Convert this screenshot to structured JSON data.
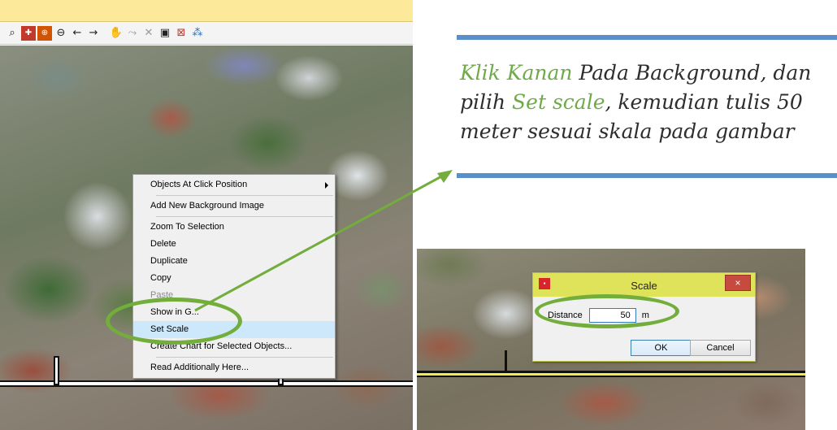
{
  "toolbar": {
    "icons": [
      "zoom-fit-icon",
      "zoom-extent-icon",
      "zoom-in-icon",
      "zoom-out-icon",
      "back-arrow-icon",
      "forward-arrow-icon",
      "pan-hand-icon",
      "route-icon",
      "delete-route-icon",
      "camera-icon",
      "remove-objects-icon",
      "network-icon"
    ]
  },
  "context_menu": {
    "items": [
      {
        "label": "Objects At Click Position",
        "submenu": true,
        "enabled": true
      },
      {
        "label": "Add New Background Image",
        "enabled": true
      },
      {
        "label": "Zoom To Selection",
        "enabled": true
      },
      {
        "label": "Delete",
        "enabled": true
      },
      {
        "label": "Duplicate",
        "enabled": true
      },
      {
        "label": "Copy",
        "enabled": true
      },
      {
        "label": "Paste",
        "enabled": false
      },
      {
        "label": "Show in G...",
        "enabled": true
      },
      {
        "label": "Set Scale",
        "enabled": true,
        "highlighted": true
      },
      {
        "label": "Create Chart for Selected Objects...",
        "enabled": true
      },
      {
        "label": "Read Additionally Here...",
        "enabled": true
      }
    ]
  },
  "instruction": {
    "part1_accent": "Klik Kanan",
    "part2": " Pada Background, dan pilih ",
    "part3_accent": "Set scale",
    "part4": ", kemudian tulis 50 meter sesuai skala pada gambar"
  },
  "colors": {
    "accent_green": "#6faa48",
    "rule_blue": "#5b8fc9",
    "highlight_ellipse": "#73ad3c"
  },
  "scale_dialog": {
    "title": "Scale",
    "close_label": "×",
    "distance_label": "Distance",
    "distance_value": "50",
    "unit": "m",
    "ok_label": "OK",
    "cancel_label": "Cancel"
  }
}
